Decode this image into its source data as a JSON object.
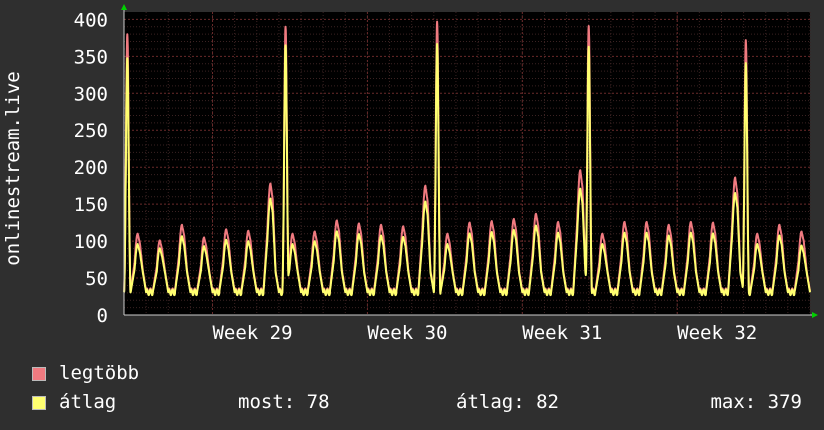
{
  "colors": {
    "background": "#2f2f2f",
    "plot_background": "#000000",
    "grid": "#6a2a2a",
    "max_line": "#f07a80",
    "avg_line": "#ffff70",
    "arrow": "#00d000",
    "text": "#ffffff"
  },
  "legend": {
    "max_label": "legtöbb",
    "avg_label": "átlag",
    "now_text": "most: 78",
    "avg_text": "átlag: 82",
    "max_text": "max: 379"
  },
  "chart_data": {
    "type": "line",
    "title": "",
    "xlabel": "",
    "ylabel": "onlinestream.live",
    "ylim": [
      0,
      410
    ],
    "yticks": [
      0,
      50,
      100,
      150,
      200,
      250,
      300,
      350,
      400
    ],
    "xlim": [
      0,
      31
    ],
    "xticks": [
      {
        "x": 4,
        "label": "Week 29"
      },
      {
        "x": 11,
        "label": "Week 30"
      },
      {
        "x": 18,
        "label": "Week 31"
      },
      {
        "x": 25,
        "label": "Week 32"
      }
    ],
    "grid": true,
    "peaks": [
      {
        "day": 0.15,
        "max": 380,
        "avg": 362
      },
      {
        "day": 7.3,
        "max": 390,
        "avg": 380
      },
      {
        "day": 14.15,
        "max": 397,
        "avg": 382
      },
      {
        "day": 21.0,
        "max": 391,
        "avg": 378
      },
      {
        "day": 28.1,
        "max": 372,
        "avg": 355
      }
    ],
    "day_values": {
      "days": [
        1,
        2,
        3,
        4,
        5,
        6,
        8,
        9,
        10,
        11,
        12,
        13,
        15,
        16,
        17,
        18,
        19,
        20,
        22,
        23,
        24,
        25,
        26,
        27,
        29,
        30
      ],
      "max": [
        101,
        122,
        105,
        116,
        114,
        178,
        113,
        128,
        124,
        122,
        120,
        175,
        125,
        127,
        130,
        137,
        126,
        196,
        126,
        126,
        122,
        126,
        125,
        186,
        122,
        113
      ],
      "avg": [
        94,
        111,
        97,
        106,
        104,
        164,
        104,
        118,
        114,
        112,
        110,
        160,
        115,
        117,
        120,
        126,
        116,
        178,
        116,
        116,
        112,
        116,
        115,
        172,
        112,
        98
      ]
    },
    "series": [
      {
        "name": "legtöbb",
        "color": "#f07a80"
      },
      {
        "name": "átlag",
        "color": "#ffff70"
      }
    ],
    "current": 78,
    "average": 82,
    "maximum": 379
  }
}
